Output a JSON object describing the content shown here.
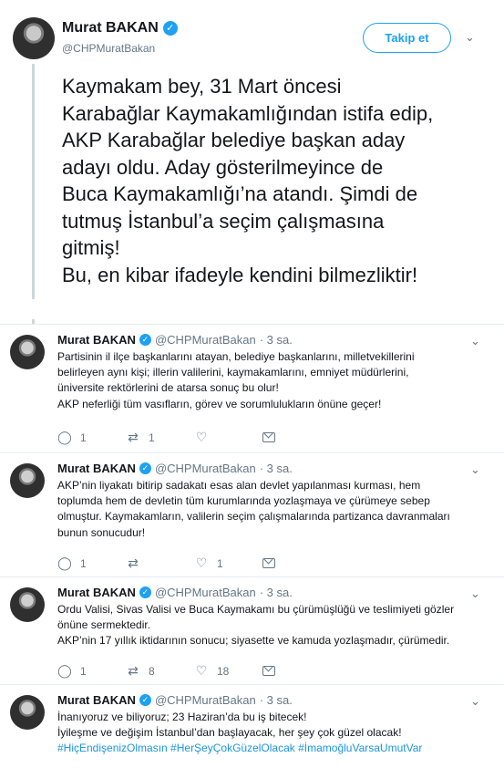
{
  "main_tweet": {
    "name": "Murat BAKAN",
    "handle": "@CHPMuratBakan",
    "follow_label": "Takip et",
    "text": "Kaymakam bey, 31 Mart öncesi\nKarabağlar Kaymakamlığından istifa edip,\nAKP Karabağlar belediye başkan aday\nadayı oldu. Aday gösterilmeyince de\nBuca Kaymakamlığı’na atandı. Şimdi de\ntutmuş İstanbul’a seçim çalışmasına\ngitmiş!\nBu, en kibar ifadeyle kendini bilmezliktir!"
  },
  "replies": [
    {
      "name": "Murat BAKAN",
      "handle": "@CHPMuratBakan",
      "time": "· 3 sa.",
      "lines": [
        "Partisinin il ilçe başkanlarını atayan, belediye başkanlarını, milletvekillerini",
        "belirleyen aynı kişi; illerin valilerini, kaymakamlarını, emniyet müdürlerini,",
        "üniversite rektörlerini de atarsa sonuç bu olur!",
        "AKP neferliği tüm vasıfların, görev ve sorumlulukların önüne geçer!"
      ],
      "replies_count": "1",
      "retweets_count": "1",
      "likes_count": ""
    },
    {
      "name": "Murat BAKAN",
      "handle": "@CHPMuratBakan",
      "time": "· 3 sa.",
      "lines": [
        "AKP’nin liyakatı bitirip sadakatı esas alan devlet yapılanması kurması, hem",
        "toplumda hem de devletin tüm kurumlarında yozlaşmaya ve çürümeye sebep",
        "olmuştur. Kaymakamların, valilerin seçim çalışmalarında partizanca davranmaları",
        "bunun sonucudur!"
      ],
      "replies_count": "1",
      "retweets_count": "",
      "likes_count": "1"
    },
    {
      "name": "Murat BAKAN",
      "handle": "@CHPMuratBakan",
      "time": "· 3 sa.",
      "lines": [
        "Ordu Valisi, Sivas Valisi ve Buca Kaymakamı bu çürümüşlüğü ve teslimiyeti gözler",
        "önüne sermektedir.",
        "AKP’nin 17 yıllık iktidarının sonucu; siyasette ve kamuda yozlaşmadır, çürümedir."
      ],
      "replies_count": "1",
      "retweets_count": "8",
      "likes_count": "18"
    },
    {
      "name": "Murat BAKAN",
      "handle": "@CHPMuratBakan",
      "time": "· 3 sa.",
      "lines": [
        "İnanıyoruz ve biliyoruz; 23 Haziran’da bu iş bitecek!",
        "İyileşme ve değişim İstanbul’dan başlayacak, her şey çok güzel olacak!"
      ],
      "hashtags": "#HiçEndişenizOlmasın #HerŞeyÇokGüzelOlacak #İmamoğluVarsaUmutVar"
    }
  ],
  "colors": {
    "accent": "#1da1f2",
    "hashtag": "#1b95e0",
    "muted": "#657786"
  }
}
